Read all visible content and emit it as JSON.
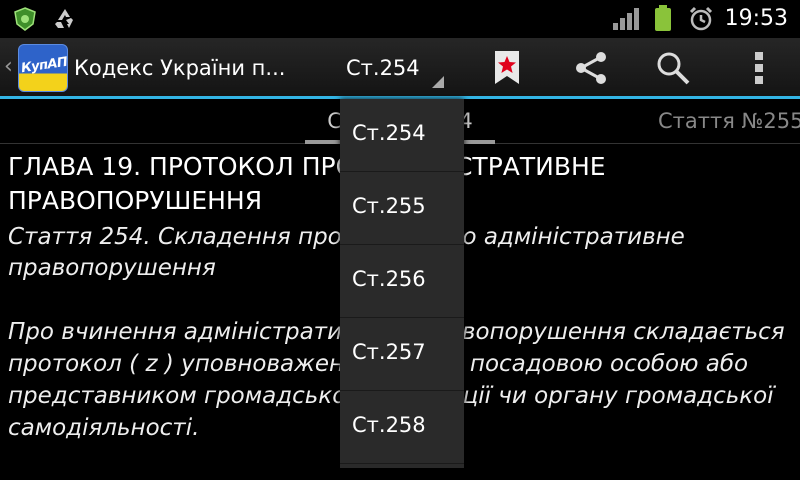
{
  "status_bar": {
    "time": "19:53",
    "icons": [
      "shield-notification-icon",
      "recycle-icon",
      "signal-icon",
      "battery-icon",
      "alarm-icon"
    ]
  },
  "action_bar": {
    "logo_text": "КупАП",
    "title": "Кодекс України п...",
    "spinner_value": "Ст.254",
    "buttons": [
      "bookmark-icon",
      "share-icon",
      "search-icon",
      "overflow-menu-icon"
    ],
    "accent_color": "#33b5e5",
    "bookmark_star_color": "#e0001b"
  },
  "tabs": {
    "current": "Стаття №254",
    "next": "Стаття №255"
  },
  "content": {
    "chapter": "ГЛАВА 19.  ПРОТОКОЛ ПРО АДМІНІСТРАТИВНЕ ПРАВОПОРУШЕННЯ",
    "article_title": "Стаття 254. Складення протоколу про адміністративне правопорушення",
    "body": "Про вчинення адміністративного правопорушення складається протокол ( z ) уповноваженими на те посадовою особою або представником громадської організації чи органу громадської самодіяльності."
  },
  "dropdown": {
    "items": [
      "Ст.254",
      "Ст.255",
      "Ст.256",
      "Ст.257",
      "Ст.258"
    ]
  }
}
